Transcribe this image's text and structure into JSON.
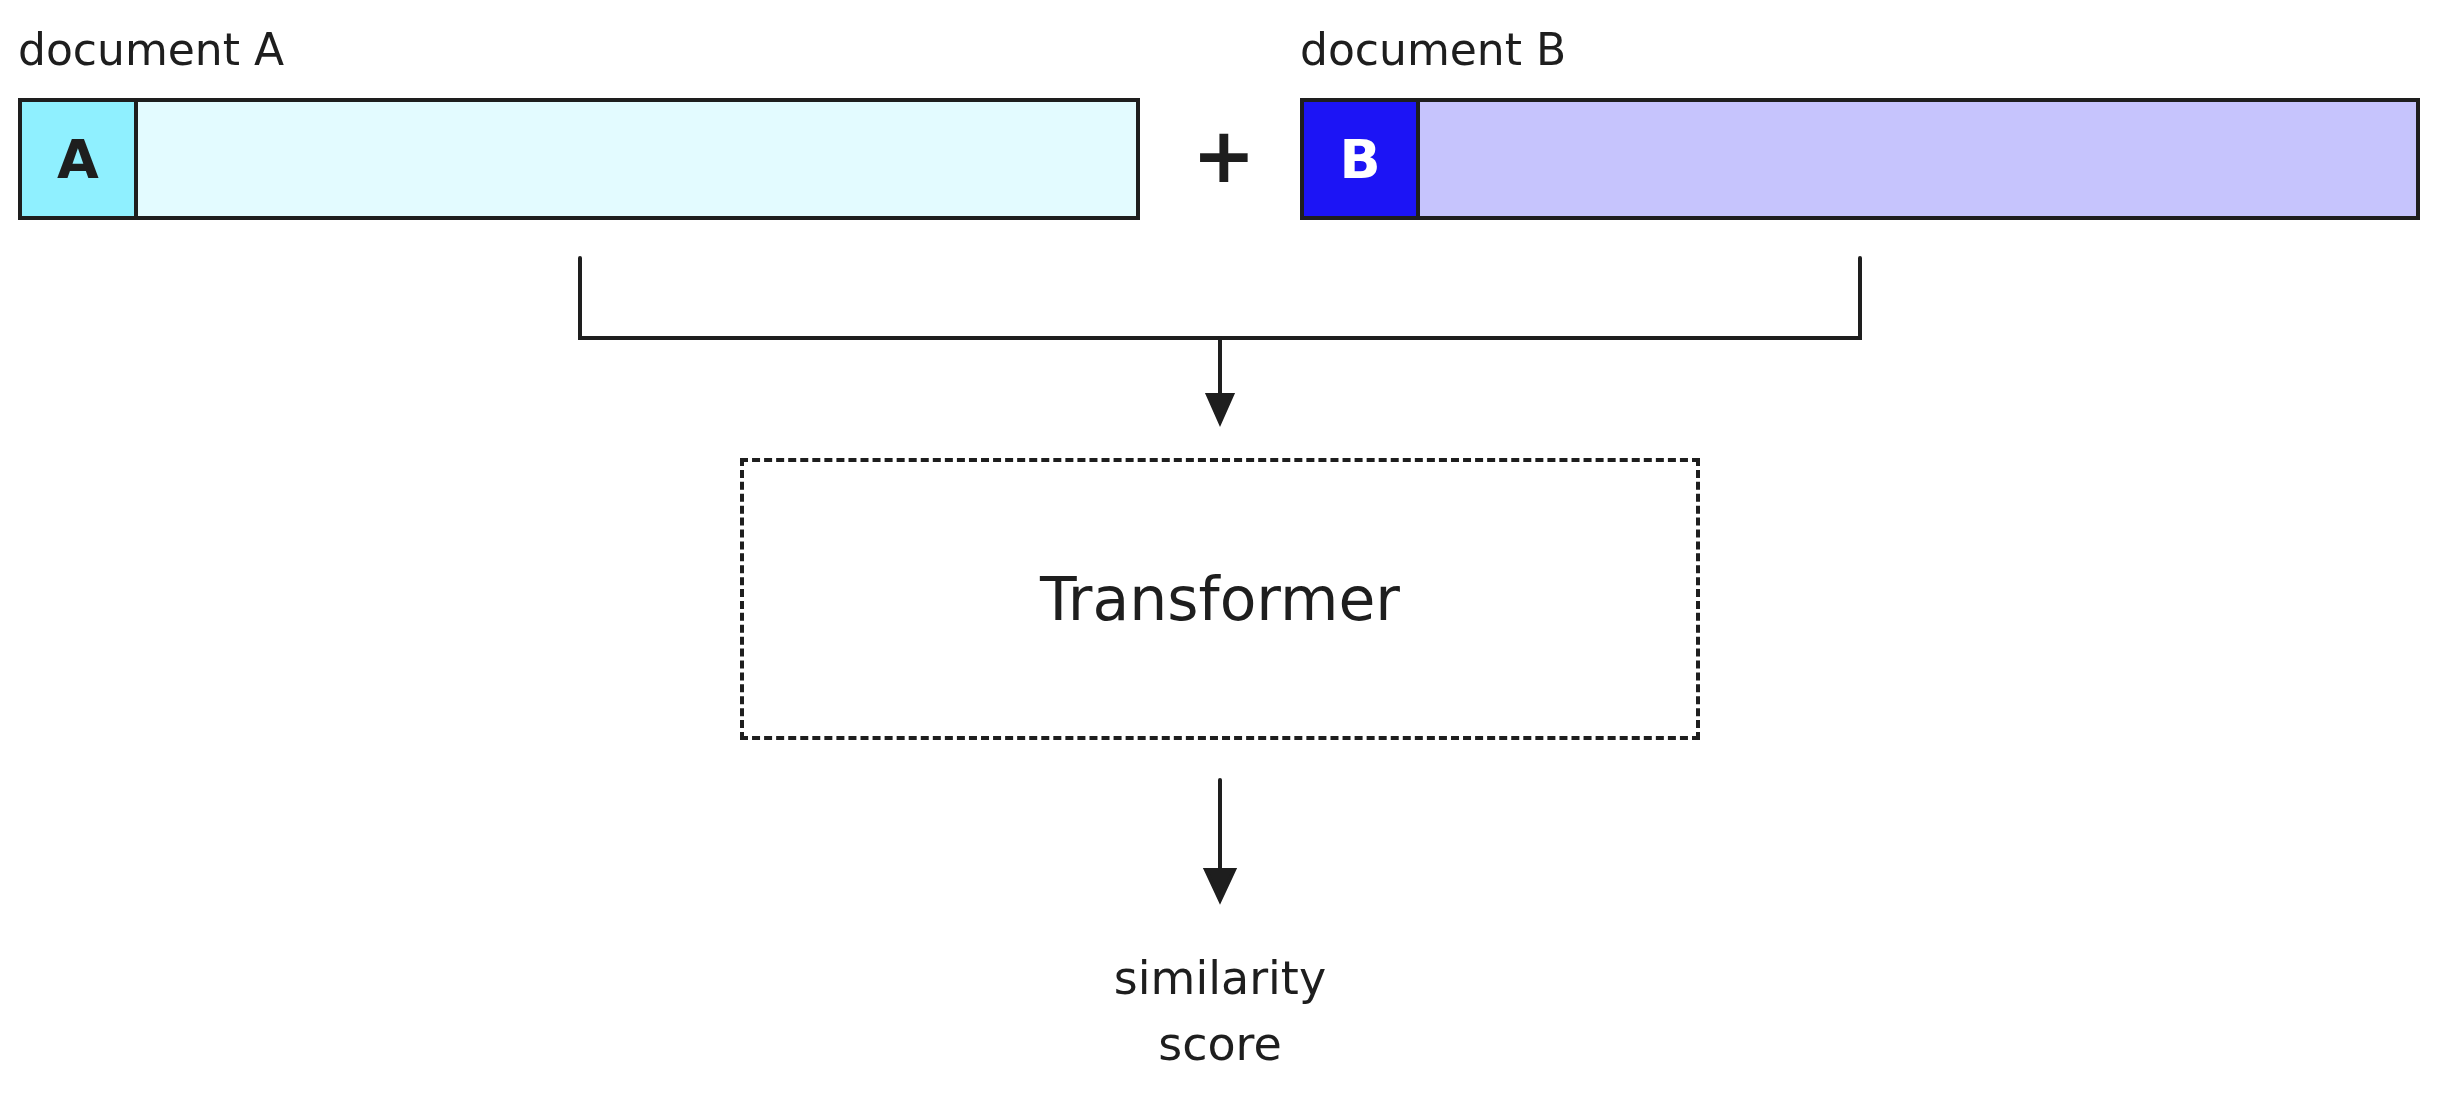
{
  "documents": [
    {
      "label": "document A",
      "token": "A",
      "color": "#8ff0ff"
    },
    {
      "label": "document B",
      "token": "B",
      "color": "#1c14f5"
    }
  ],
  "join_symbol": "+",
  "model": {
    "label": "Transformer"
  },
  "output": {
    "lines": [
      "similarity",
      "score"
    ]
  }
}
